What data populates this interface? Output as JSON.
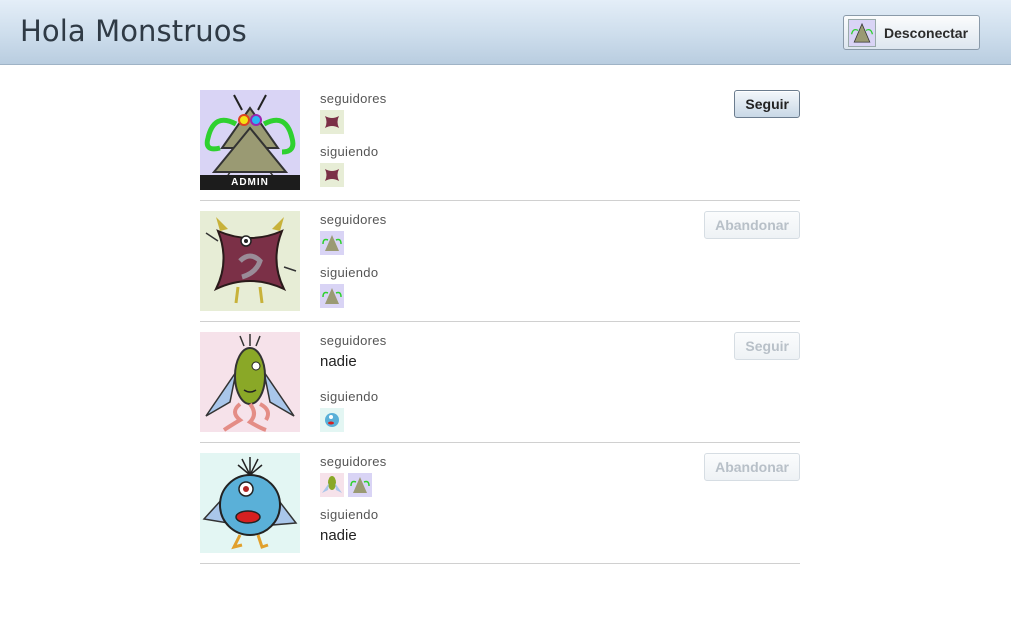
{
  "header": {
    "title": "Hola Monstruos",
    "logout_label": "Desconectar"
  },
  "labels": {
    "followers": "seguidores",
    "following": "siguiendo",
    "nobody": "nadie"
  },
  "monsters": [
    {
      "avatar": "triangle-monster-icon",
      "badge": "ADMIN",
      "followers": [
        "heart-monster-icon"
      ],
      "following": [
        "heart-monster-icon"
      ],
      "action": "Seguir",
      "action_enabled": true
    },
    {
      "avatar": "heart-monster-icon",
      "badge": "",
      "followers": [
        "triangle-monster-icon"
      ],
      "following": [
        "triangle-monster-icon"
      ],
      "action": "Abandonar",
      "action_enabled": false
    },
    {
      "avatar": "green-oval-monster-icon",
      "badge": "",
      "followers": [],
      "following": [
        "blue-cyclops-monster-icon"
      ],
      "action": "Seguir",
      "action_enabled": false
    },
    {
      "avatar": "blue-cyclops-monster-icon",
      "badge": "",
      "followers": [
        "green-oval-monster-icon",
        "triangle-monster-icon"
      ],
      "following": [],
      "action": "Abandonar",
      "action_enabled": false
    }
  ],
  "colors": {
    "triangle_bg": "#d9d4f5",
    "heart_bg": "#e7edd6",
    "oval_bg": "#f6e2ea",
    "cyclops_bg": "#e3f6f3"
  }
}
